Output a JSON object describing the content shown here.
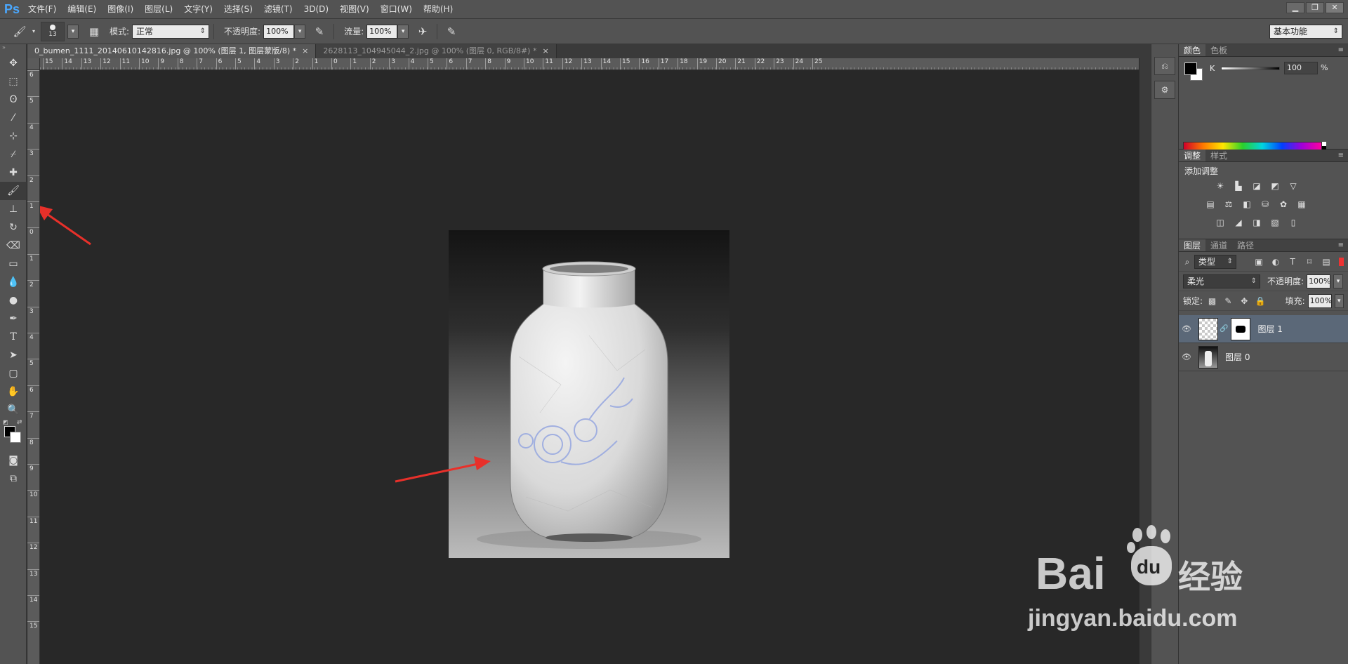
{
  "app": {
    "logo": "Ps",
    "menu": [
      "文件(F)",
      "编辑(E)",
      "图像(I)",
      "图层(L)",
      "文字(Y)",
      "选择(S)",
      "滤镜(T)",
      "3D(D)",
      "视图(V)",
      "窗口(W)",
      "帮助(H)"
    ],
    "window_controls": [
      "minimize",
      "restore",
      "close"
    ]
  },
  "options_bar": {
    "brush_size": "13",
    "mode_label": "模式:",
    "mode_value": "正常",
    "opacity_label": "不透明度:",
    "opacity_value": "100%",
    "flow_label": "流量:",
    "flow_value": "100%",
    "workspace": "基本功能"
  },
  "tabs": [
    {
      "title": "0_bumen_1111_20140610142816.jpg @ 100% (图层 1, 图层蒙版/8) *",
      "active": true
    },
    {
      "title": "2628113_104945044_2.jpg @ 100% (图层 0, RGB/8#) *",
      "active": false
    }
  ],
  "rulers": {
    "top_labels": [
      "15",
      "14",
      "13",
      "12",
      "11",
      "10",
      "9",
      "8",
      "7",
      "6",
      "5",
      "4",
      "3",
      "2",
      "1",
      "0",
      "1",
      "2",
      "3",
      "4",
      "5",
      "6",
      "7",
      "8",
      "9",
      "10",
      "11",
      "12",
      "13",
      "14",
      "15",
      "16",
      "17",
      "18",
      "19",
      "20",
      "21",
      "22",
      "23",
      "24",
      "25"
    ],
    "left_labels": [
      "6",
      "5",
      "4",
      "3",
      "2",
      "1",
      "0",
      "1",
      "2",
      "3",
      "4",
      "5",
      "6",
      "7",
      "8",
      "9",
      "10",
      "11",
      "12",
      "13",
      "14",
      "15"
    ]
  },
  "tools": [
    "move-tool",
    "marquee-tool",
    "lasso-tool",
    "quick-selection-tool",
    "crop-tool",
    "eyedropper-tool",
    "healing-brush-tool",
    "brush-tool",
    "clone-stamp-tool",
    "history-brush-tool",
    "eraser-tool",
    "gradient-tool",
    "blur-tool",
    "dodge-tool",
    "pen-tool",
    "type-tool",
    "path-selection-tool",
    "rectangle-tool",
    "hand-tool",
    "zoom-tool"
  ],
  "color_panel": {
    "tabs": [
      "颜色",
      "色板"
    ],
    "channel": "K",
    "value": "100",
    "unit": "%",
    "foreground": "#000000",
    "background": "#ffffff"
  },
  "adjust_panel": {
    "tabs": [
      "调整",
      "样式"
    ],
    "title": "添加调整"
  },
  "layers_panel": {
    "tabs": [
      "图层",
      "通道",
      "路径"
    ],
    "filter_kind": "类型",
    "blend_mode": "柔光",
    "opacity_label": "不透明度:",
    "opacity_value": "100%",
    "lock_label": "锁定:",
    "fill_label": "填充:",
    "fill_value": "100%",
    "layers": [
      {
        "name": "图层 1",
        "selected": true
      },
      {
        "name": "图层 0",
        "selected": false
      }
    ]
  },
  "watermark": {
    "brand": "Bai",
    "brand_du": "du",
    "product": "经验",
    "url": "jingyan.baidu.com"
  },
  "colors": {
    "annotation_arrow": "#e8302a",
    "accent": "#4aa8ff"
  }
}
